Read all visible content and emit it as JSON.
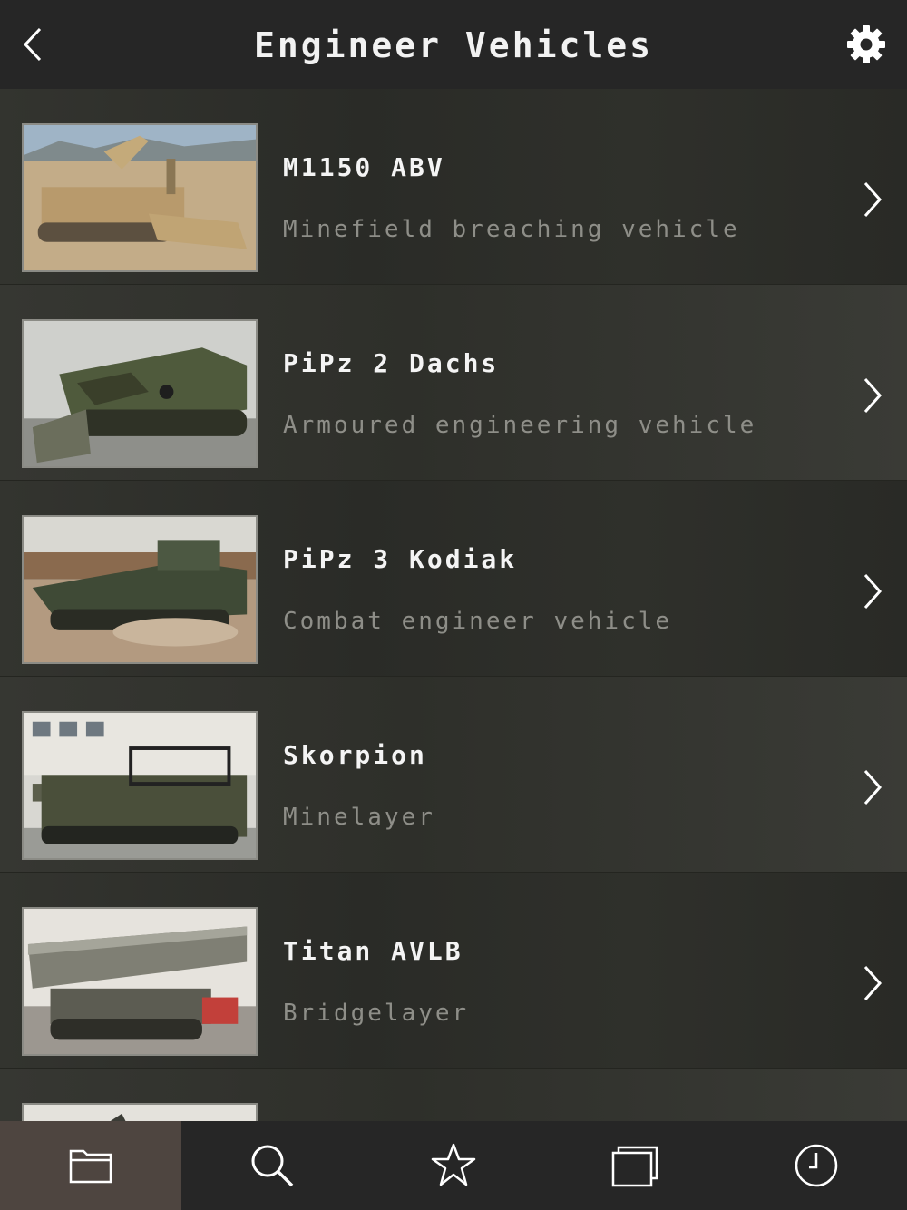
{
  "header": {
    "title": "Engineer Vehicles",
    "back_icon": "chevron-left-icon",
    "settings_icon": "gear-icon"
  },
  "vehicles": [
    {
      "name": "M1150 ABV",
      "subtitle": "Minefield breaching vehicle",
      "image": "desert tan mine-clearing tank photo"
    },
    {
      "name": "PiPz 2 Dachs",
      "subtitle": "Armoured engineering vehicle",
      "image": "green camouflage engineering tank photo"
    },
    {
      "name": "PiPz 3 Kodiak",
      "subtitle": "Combat engineer vehicle",
      "image": "green tracked vehicle kicking up dust photo"
    },
    {
      "name": "Skorpion",
      "subtitle": "Minelayer",
      "image": "camouflaged tracked minelayer photo"
    },
    {
      "name": "Titan AVLB",
      "subtitle": "Bridgelayer",
      "image": "bridgelaying tank photo"
    },
    {
      "name": "",
      "subtitle": "",
      "image": "partially visible vehicle photo"
    }
  ],
  "tabs": [
    {
      "name": "folder-icon",
      "active": true
    },
    {
      "name": "search-icon",
      "active": false
    },
    {
      "name": "star-icon",
      "active": false
    },
    {
      "name": "windows-icon",
      "active": false
    },
    {
      "name": "clock-icon",
      "active": false
    }
  ],
  "colors": {
    "navbar": "#262626",
    "active_tab": "#4e4540",
    "title_text": "#f4f4f4",
    "subtitle_text": "#8e8e88"
  }
}
